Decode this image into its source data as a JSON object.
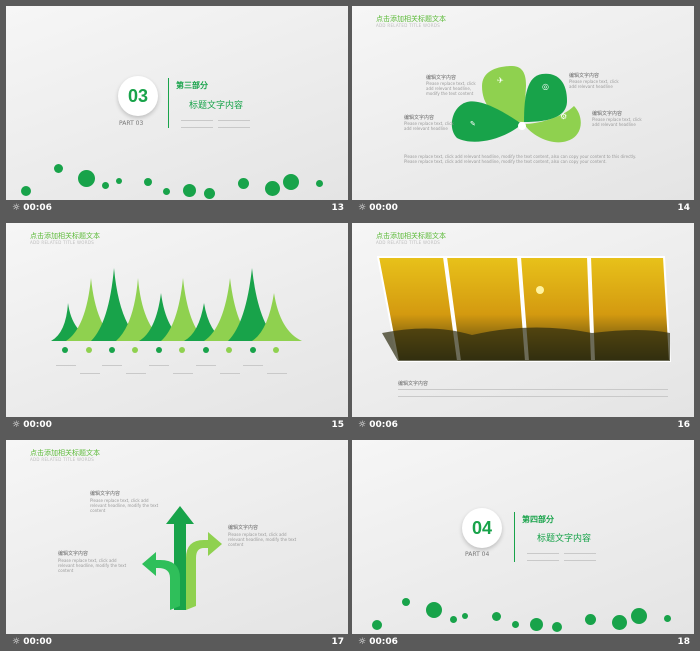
{
  "slides": [
    {
      "time": "00:06",
      "num": "13",
      "badge": "03",
      "part_cn": "第三部分",
      "heading": "标题文字内容",
      "part_en": "PART 03"
    },
    {
      "time": "00:00",
      "num": "14",
      "title": "点击添加相关标题文本",
      "sub": "ADD RELATED TITLE WORDS",
      "labels": [
        "编辑文字内容",
        "编辑文字内容",
        "编辑文字内容",
        "编辑文字内容"
      ]
    },
    {
      "time": "00:00",
      "num": "15",
      "title": "点击添加相关标题文本",
      "sub": "ADD RELATED TITLE WORDS"
    },
    {
      "time": "00:06",
      "num": "16",
      "title": "点击添加相关标题文本",
      "sub": "ADD RELATED TITLE WORDS",
      "label": "编辑文字内容"
    },
    {
      "time": "00:00",
      "num": "17",
      "title": "点击添加相关标题文本",
      "sub": "ADD RELATED TITLE WORDS",
      "labels": [
        "编辑文字内容",
        "编辑文字内容",
        "编辑文字内容"
      ]
    },
    {
      "time": "00:06",
      "num": "18",
      "badge": "04",
      "part_cn": "第四部分",
      "heading": "标题文字内容",
      "part_en": "PART 04"
    }
  ],
  "colors": {
    "green": "#18a34a",
    "light_green": "#8fd14f",
    "bar": "#5a5a5a"
  }
}
